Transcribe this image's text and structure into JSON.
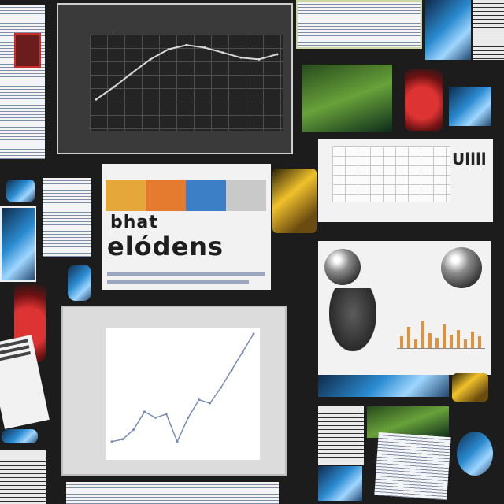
{
  "collage": {
    "big_word": "elódens",
    "small_word": "bhat",
    "title_fragment": "Ullll"
  },
  "colors": {
    "background": "#1c1c1c",
    "dark_chart_line": "#d8d8d8",
    "light_chart_line": "#7a8fb5",
    "bar_color": "#e2913b"
  },
  "dark_chart": {
    "type": "line",
    "x": [
      0,
      1,
      2,
      3,
      4,
      5,
      6,
      7,
      8,
      9,
      10
    ],
    "y": [
      0.3,
      0.45,
      0.62,
      0.78,
      0.9,
      0.95,
      0.92,
      0.86,
      0.8,
      0.78,
      0.84
    ],
    "ylim": [
      0,
      1
    ]
  },
  "light_chart": {
    "type": "line",
    "x": [
      0,
      1,
      2,
      3,
      4,
      5,
      6,
      7,
      8,
      9,
      10,
      11,
      12,
      13
    ],
    "y": [
      0.1,
      0.12,
      0.2,
      0.35,
      0.3,
      0.33,
      0.1,
      0.3,
      0.45,
      0.42,
      0.55,
      0.7,
      0.85,
      1.0
    ],
    "ylim": [
      0,
      1
    ]
  },
  "bar_chart": {
    "type": "bar",
    "values": [
      0.4,
      0.7,
      0.3,
      0.9,
      0.5,
      0.35,
      0.8,
      0.45,
      0.6,
      0.3,
      0.55,
      0.4
    ],
    "ylim": [
      0,
      1
    ]
  }
}
